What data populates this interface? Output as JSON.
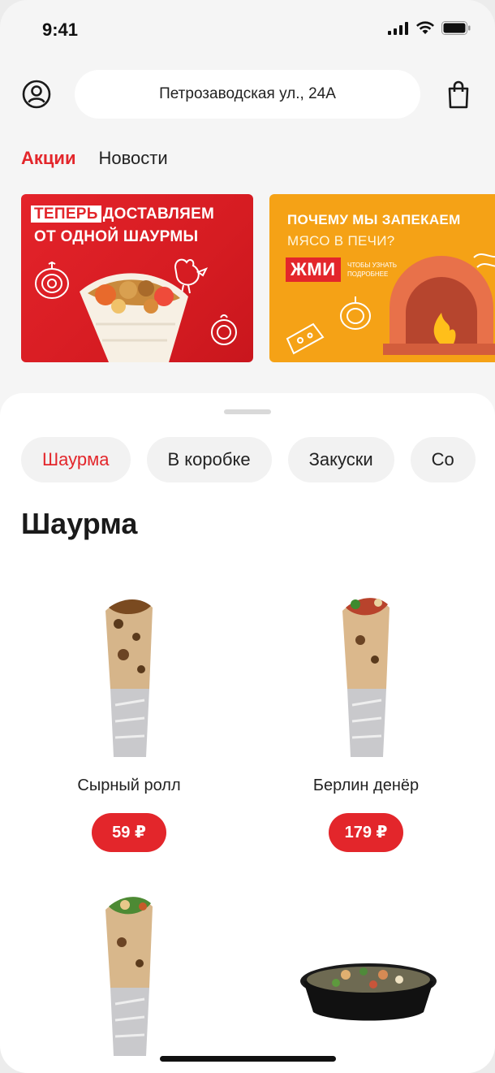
{
  "status": {
    "time": "9:41"
  },
  "header": {
    "address": "Петрозаводская ул.,  24А"
  },
  "top_tabs": [
    {
      "label": "Акции",
      "active": true
    },
    {
      "label": "Новости",
      "active": false
    }
  ],
  "banners": [
    {
      "tag": "ТЕПЕРЬ",
      "line1": "ДОСТАВЛЯЕМ",
      "line2": "ОТ ОДНОЙ ШАУРМЫ"
    },
    {
      "line1": "ПОЧЕМУ МЫ ЗАПЕКАЕМ",
      "line2": "МЯСО В ПЕЧИ?",
      "press": "ЖМИ",
      "small": "ЧТОБЫ УЗНАТЬ ПОДРОБНЕЕ"
    }
  ],
  "categories": [
    {
      "label": "Шаурма",
      "active": true
    },
    {
      "label": "В коробке",
      "active": false
    },
    {
      "label": "Закуски",
      "active": false
    },
    {
      "label": "Со",
      "active": false
    }
  ],
  "section_title": "Шаурма",
  "products": [
    {
      "name": "Сырный ролл",
      "price": "59 ₽"
    },
    {
      "name": "Берлин денёр",
      "price": "179 ₽"
    },
    {
      "name": "",
      "price": ""
    },
    {
      "name": "",
      "price": ""
    }
  ],
  "colors": {
    "accent": "#e3262b",
    "banner_orange": "#f5a216",
    "background": "#f5f5f5"
  }
}
